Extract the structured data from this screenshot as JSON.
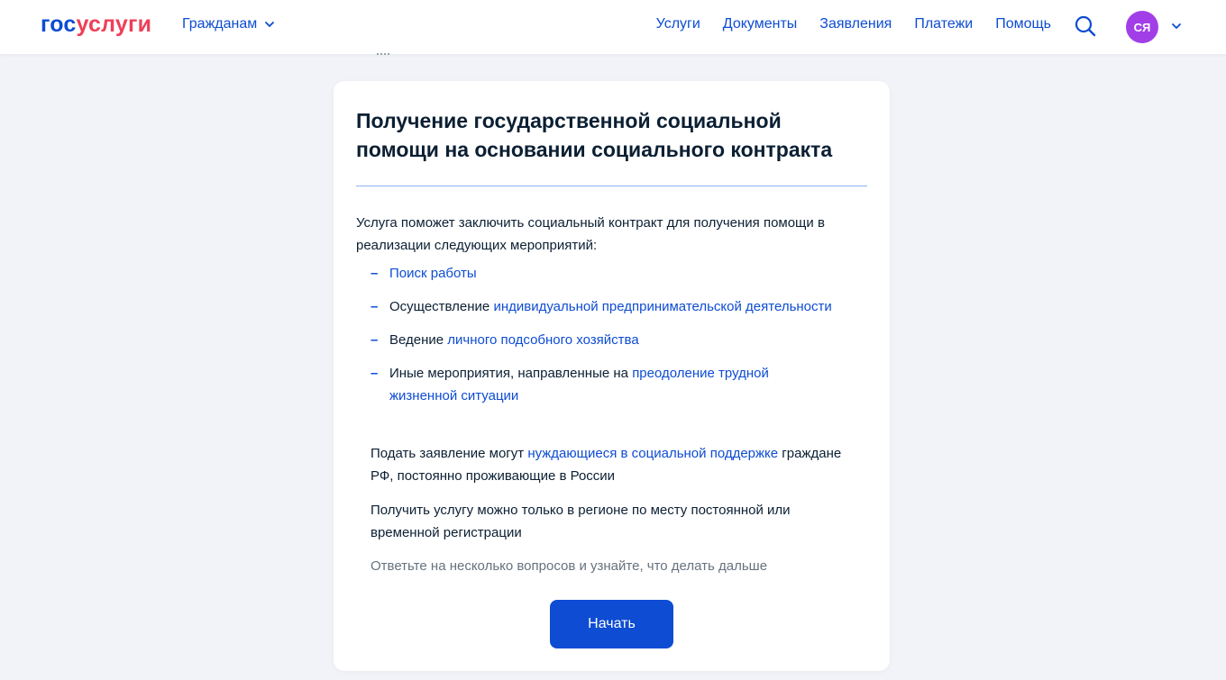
{
  "header": {
    "logo_part1": "гос",
    "logo_part2": "услуги",
    "audience_label": "Гражданам",
    "nav": [
      "Услуги",
      "Документы",
      "Заявления",
      "Платежи",
      "Помощь"
    ],
    "avatar_initials": "СЯ"
  },
  "card": {
    "title": "Получение государственной социальной помощи на основании социального контракта",
    "intro": "Услуга поможет заключить социальный контракт для получения помощи в реализации следующих мероприятий:",
    "items": [
      {
        "prefix": "",
        "link": "Поиск работы"
      },
      {
        "prefix": "Осуществление ",
        "link": "индивидуальной предпринимательской деятельности"
      },
      {
        "prefix": "Ведение ",
        "link": "личного подсобного хозяйства"
      },
      {
        "prefix": "Иные мероприятия, направленные на ",
        "link": "преодоление трудной жизненной ситуации"
      }
    ],
    "eligibility_prefix": "Подать заявление могут ",
    "eligibility_link": "нуждающиеся в социальной поддержке",
    "eligibility_suffix": " граждане РФ, постоянно проживающие в России",
    "region_note": "Получить услугу можно только в регионе по месту постоянной или временной регистрации",
    "hint": "Ответьте на несколько вопросов и узнайте, что делать дальше",
    "start_button": "Начать"
  },
  "colors": {
    "brand_blue": "#0d4cd3",
    "brand_red": "#ee3f58",
    "avatar_bg": "#a23ee8",
    "page_bg": "#f1f3f8"
  },
  "icons": {
    "search": "search-icon",
    "chevron": "chevron-down-icon"
  }
}
